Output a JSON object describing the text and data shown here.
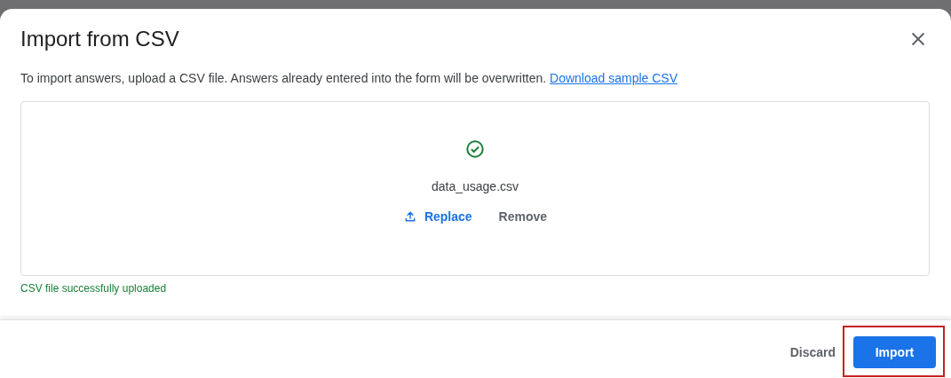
{
  "dialog": {
    "title": "Import from CSV",
    "description": "To import answers, upload a CSV file. Answers already entered into the form will be overwritten.",
    "link": "Download sample CSV",
    "upload": {
      "uploaded": true,
      "filename": "data_usage.csv",
      "replace": "Replace",
      "remove": "Remove"
    },
    "status": "CSV file successfully uploaded",
    "buttons": [
      {
        "label": "Discard",
        "kind": "text",
        "highlighted": false
      },
      {
        "label": "Import",
        "kind": "primary",
        "highlighted": true
      }
    ]
  }
}
